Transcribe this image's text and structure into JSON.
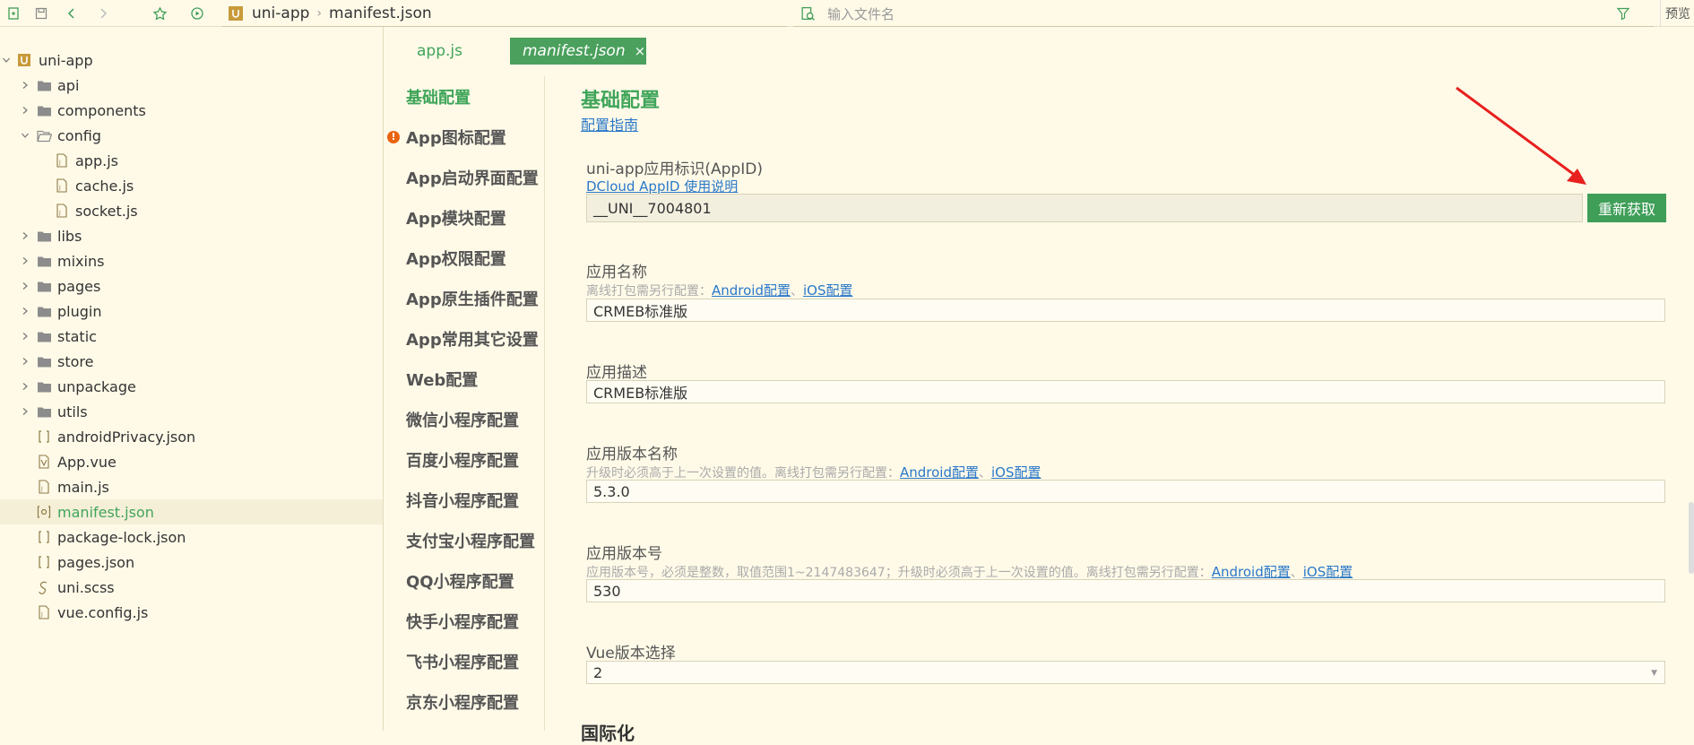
{
  "breadcrumb": {
    "project": "uni-app",
    "file": "manifest.json"
  },
  "search": {
    "placeholder": "输入文件名"
  },
  "toolbar": {
    "preview_label": "预览"
  },
  "tree": {
    "root": "uni-app",
    "items": [
      {
        "label": "api",
        "type": "folder",
        "depth": 1,
        "expanded": false
      },
      {
        "label": "components",
        "type": "folder",
        "depth": 1,
        "expanded": false
      },
      {
        "label": "config",
        "type": "folder",
        "depth": 1,
        "expanded": true
      },
      {
        "label": "app.js",
        "type": "file",
        "depth": 2
      },
      {
        "label": "cache.js",
        "type": "file",
        "depth": 2
      },
      {
        "label": "socket.js",
        "type": "file",
        "depth": 2
      },
      {
        "label": "libs",
        "type": "folder",
        "depth": 1,
        "expanded": false
      },
      {
        "label": "mixins",
        "type": "folder",
        "depth": 1,
        "expanded": false
      },
      {
        "label": "pages",
        "type": "folder",
        "depth": 1,
        "expanded": false
      },
      {
        "label": "plugin",
        "type": "folder",
        "depth": 1,
        "expanded": false
      },
      {
        "label": "static",
        "type": "folder",
        "depth": 1,
        "expanded": false
      },
      {
        "label": "store",
        "type": "folder",
        "depth": 1,
        "expanded": false
      },
      {
        "label": "unpackage",
        "type": "folder",
        "depth": 1,
        "expanded": false
      },
      {
        "label": "utils",
        "type": "folder",
        "depth": 1,
        "expanded": false
      },
      {
        "label": "androidPrivacy.json",
        "type": "json",
        "depth": 1
      },
      {
        "label": "App.vue",
        "type": "vue",
        "depth": 1
      },
      {
        "label": "main.js",
        "type": "file",
        "depth": 1
      },
      {
        "label": "manifest.json",
        "type": "manifest",
        "depth": 1,
        "selected": true
      },
      {
        "label": "package-lock.json",
        "type": "json",
        "depth": 1
      },
      {
        "label": "pages.json",
        "type": "json",
        "depth": 1
      },
      {
        "label": "uni.scss",
        "type": "scss",
        "depth": 1
      },
      {
        "label": "vue.config.js",
        "type": "file",
        "depth": 1
      }
    ]
  },
  "tabs": [
    {
      "label": "app.js",
      "active": false
    },
    {
      "label": "manifest.json",
      "active": true
    }
  ],
  "config_nav": [
    {
      "label": "基础配置",
      "active": true
    },
    {
      "label": "App图标配置",
      "warn": true
    },
    {
      "label": "App启动界面配置"
    },
    {
      "label": "App模块配置"
    },
    {
      "label": "App权限配置"
    },
    {
      "label": "App原生插件配置"
    },
    {
      "label": "App常用其它设置"
    },
    {
      "label": "Web配置"
    },
    {
      "label": "微信小程序配置"
    },
    {
      "label": "百度小程序配置"
    },
    {
      "label": "抖音小程序配置"
    },
    {
      "label": "支付宝小程序配置"
    },
    {
      "label": "QQ小程序配置"
    },
    {
      "label": "快手小程序配置"
    },
    {
      "label": "飞书小程序配置"
    },
    {
      "label": "京东小程序配置"
    }
  ],
  "main": {
    "title": "基础配置",
    "guide_link": "配置指南",
    "appid": {
      "label": "uni-app应用标识(AppID)",
      "help_link": "DCloud AppID 使用说明",
      "value": "__UNI__7004801",
      "refetch_label": "重新获取"
    },
    "app_name": {
      "label": "应用名称",
      "hint": "离线打包需另行配置：",
      "android": "Android配置",
      "sep": "、",
      "ios": "iOS配置",
      "value": "CRMEB标准版"
    },
    "app_desc": {
      "label": "应用描述",
      "value": "CRMEB标准版"
    },
    "version_name": {
      "label": "应用版本名称",
      "hint": "升级时必须高于上一次设置的值。离线打包需另行配置：",
      "android": "Android配置",
      "sep": "、",
      "ios": "iOS配置",
      "value": "5.3.0"
    },
    "version_code": {
      "label": "应用版本号",
      "hint": "应用版本号，必须是整数，取值范围1~2147483647；升级时必须高于上一次设置的值。离线打包需另行配置：",
      "android": "Android配置",
      "sep": "、",
      "ios": "iOS配置",
      "value": "530"
    },
    "vue_version": {
      "label": "Vue版本选择",
      "value": "2"
    },
    "next_section": "国际化"
  },
  "colors": {
    "accent": "#40a55a",
    "link": "#2a78c9",
    "annotation_arrow": "#e8201e",
    "background": "#fffae8"
  }
}
